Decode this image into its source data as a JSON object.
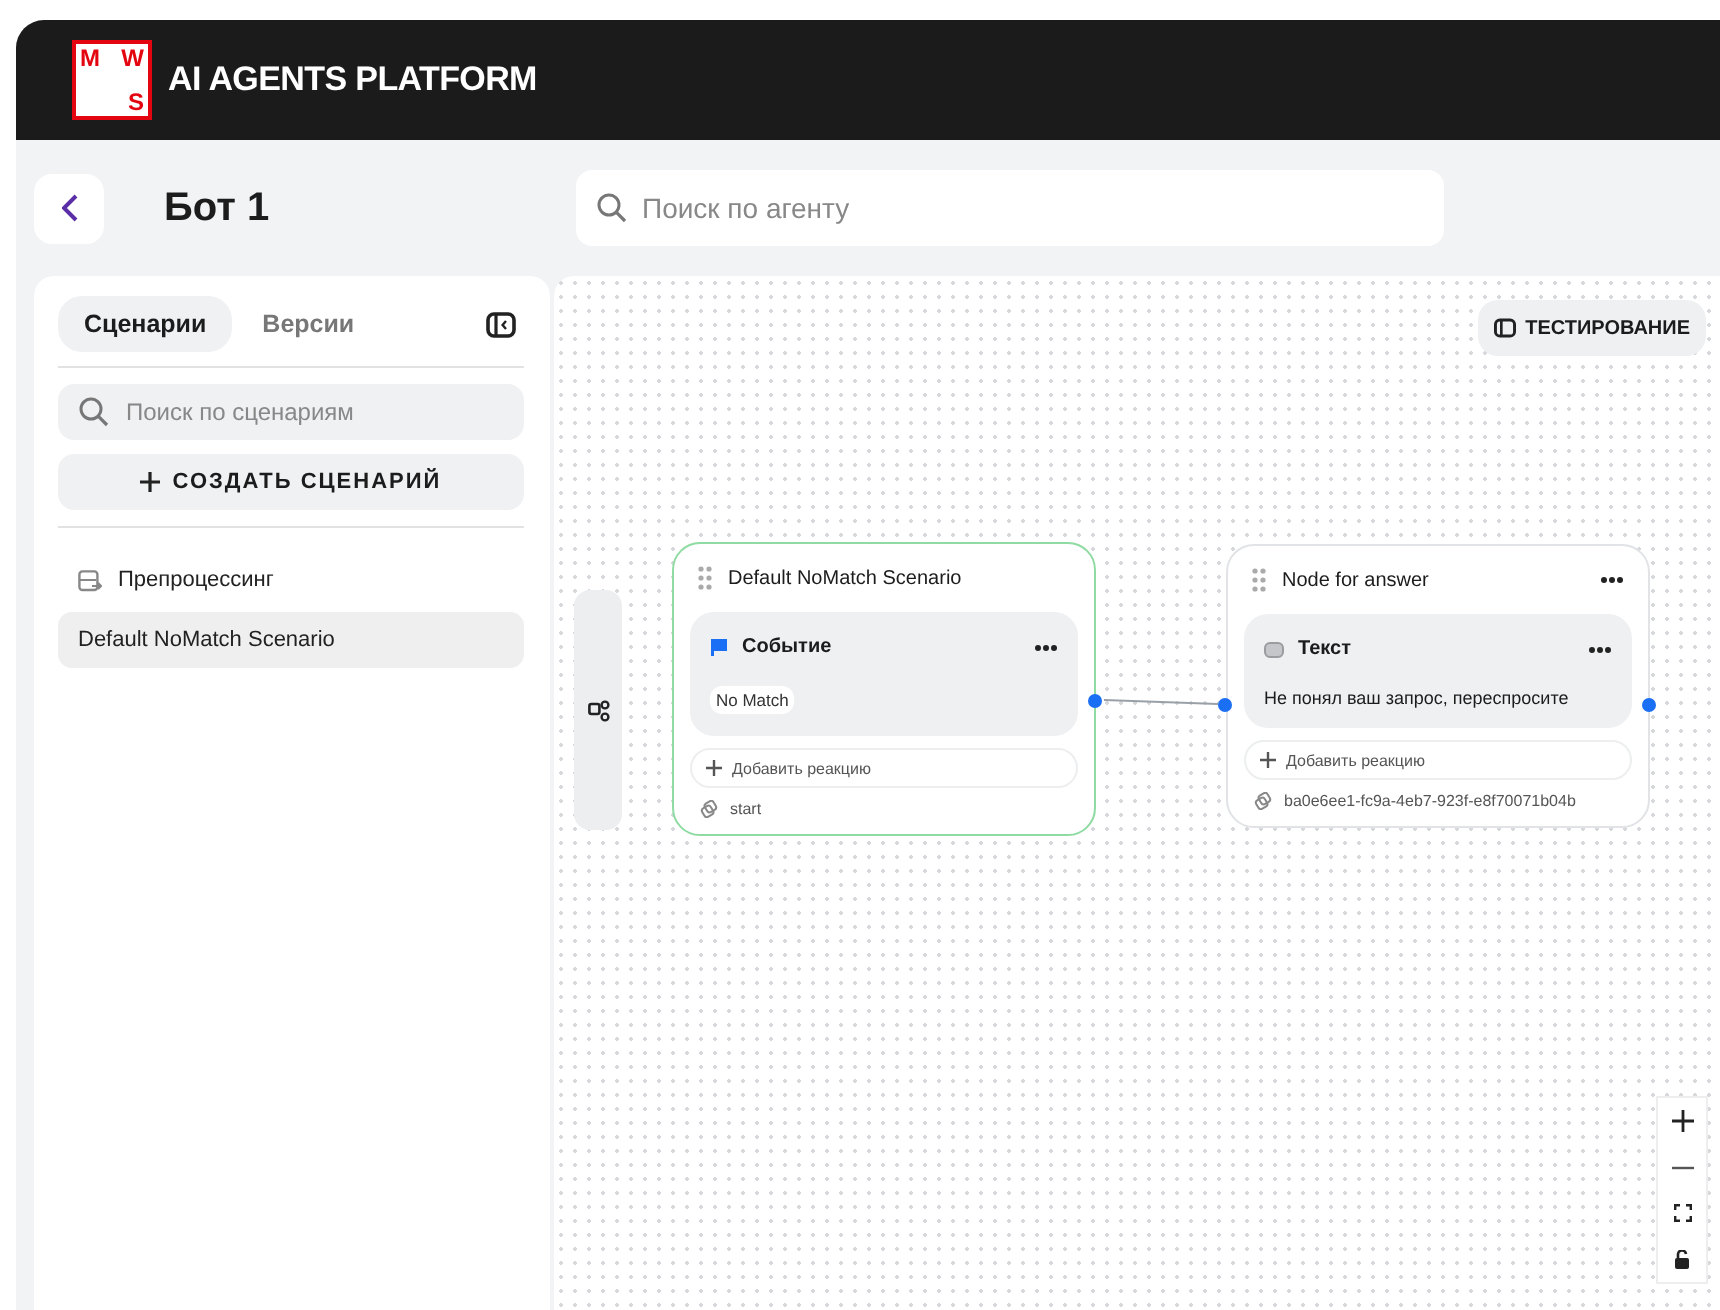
{
  "header": {
    "logo": [
      "M",
      "W",
      "S"
    ],
    "title": "AI AGENTS PLATFORM"
  },
  "toolbar": {
    "title": "Бот 1",
    "search": {
      "placeholder": "Поиск по агенту"
    }
  },
  "sidebar": {
    "tabs": [
      {
        "label": "Сценарии",
        "selected": true
      },
      {
        "label": "Версии",
        "selected": false
      }
    ],
    "search": {
      "placeholder": "Поиск по сценариям"
    },
    "create_button": "СОЗДАТЬ СЦЕНАРИЙ",
    "items": [
      {
        "label": "Препроцессинг",
        "kind": "special",
        "selected": false
      },
      {
        "label": "Default NoMatch Scenario",
        "kind": "scenario",
        "selected": true
      }
    ]
  },
  "canvas": {
    "test_button": "ТЕСТИРОВАНИЕ",
    "nodes": [
      {
        "title": "Default NoMatch Scenario",
        "active": true,
        "has_menu": false,
        "block": {
          "kind": "event",
          "title": "Событие",
          "tag": "No Match"
        },
        "add_reaction": "Добавить реакцию",
        "link": "start"
      },
      {
        "title": "Node for answer",
        "active": false,
        "has_menu": true,
        "block": {
          "kind": "text",
          "title": "Текст",
          "body": "Не понял ваш запрос, переспросите"
        },
        "add_reaction": "Добавить реакцию",
        "link": "ba0e6ee1-fc9a-4eb7-923f-e8f70071b04b"
      }
    ]
  }
}
